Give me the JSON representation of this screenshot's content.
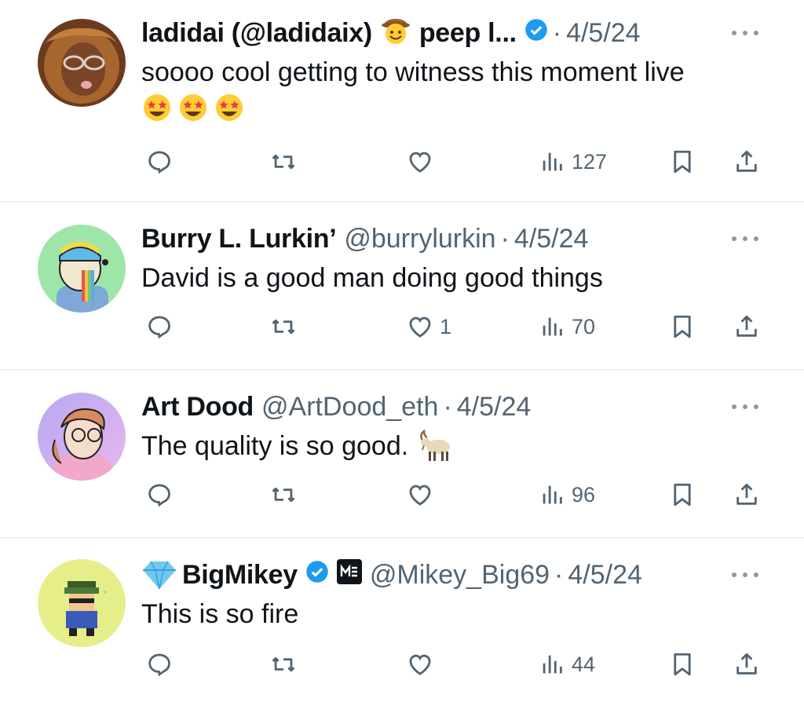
{
  "tweets": [
    {
      "name": "ladidai (@ladidaix)",
      "name_suffix": "peep l...",
      "handle": "",
      "date": "4/5/24",
      "text": "soooo cool getting to witness this moment live",
      "replies": "",
      "likes": "",
      "views": "127"
    },
    {
      "name": "Burry L. Lurkin’",
      "handle": "@burrylurkin",
      "date": "4/5/24",
      "text": "David is a good man doing good things",
      "replies": "",
      "likes": "1",
      "views": "70"
    },
    {
      "name": "Art Dood",
      "handle": "@ArtDood_eth",
      "date": "4/5/24",
      "text": "The quality is so good.",
      "replies": "",
      "likes": "",
      "views": "96"
    },
    {
      "name": "BigMikey",
      "handle": "@Mikey_Big69",
      "date": "4/5/24",
      "text": "This is so fire",
      "replies": "",
      "likes": "",
      "views": "44"
    }
  ],
  "separator": "·",
  "icons": {
    "reply": "reply-icon",
    "retweet": "retweet-icon",
    "like": "heart-icon",
    "views": "views-icon",
    "bookmark": "bookmark-icon",
    "share": "share-icon",
    "more": "more-icon",
    "verified": "verified-badge-icon"
  },
  "colors": {
    "verified": "#1d9bf0",
    "secondary_text": "#536471",
    "primary_text": "#0f1419"
  }
}
